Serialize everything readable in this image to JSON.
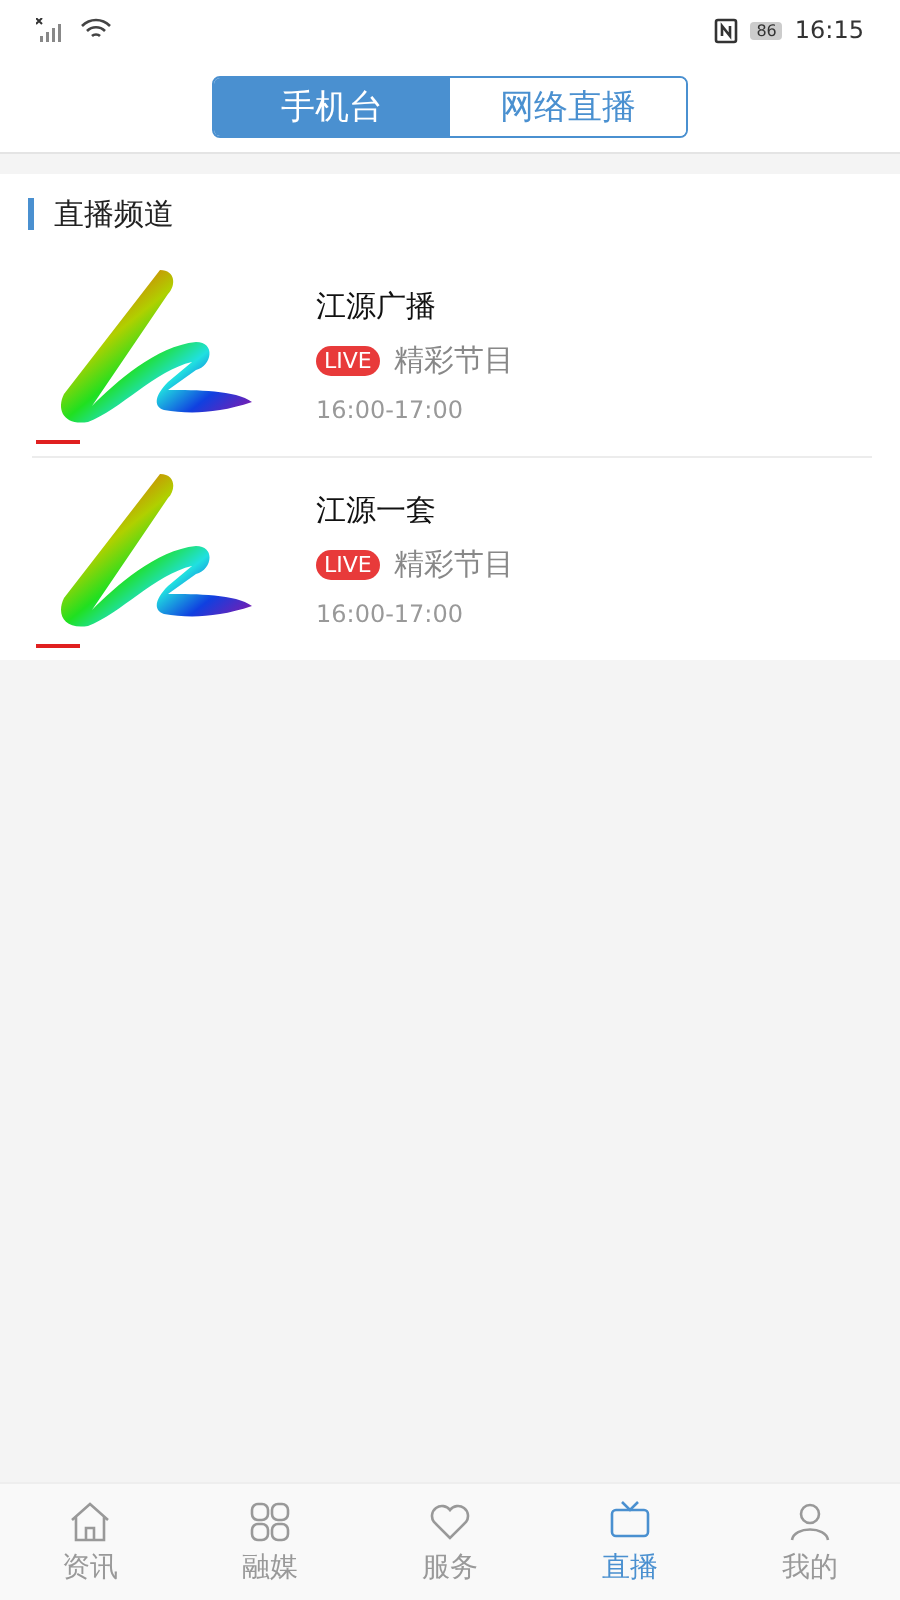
{
  "status_bar": {
    "battery": "86",
    "time": "16:15"
  },
  "segments": [
    {
      "label": "手机台",
      "selected": true
    },
    {
      "label": "网络直播",
      "selected": false
    }
  ],
  "section": {
    "title": "直播频道"
  },
  "channels": [
    {
      "name": "江源广播",
      "badge": "LIVE",
      "program": "精彩节目",
      "time": "16:00-17:00"
    },
    {
      "name": "江源一套",
      "badge": "LIVE",
      "program": "精彩节目",
      "time": "16:00-17:00"
    }
  ],
  "tab_bar": [
    {
      "label": "资讯",
      "kind": "home",
      "selected": false
    },
    {
      "label": "融媒",
      "kind": "grid",
      "selected": false
    },
    {
      "label": "服务",
      "kind": "heart",
      "selected": false
    },
    {
      "label": "直播",
      "kind": "tv",
      "selected": true
    },
    {
      "label": "我的",
      "kind": "person",
      "selected": false
    }
  ]
}
